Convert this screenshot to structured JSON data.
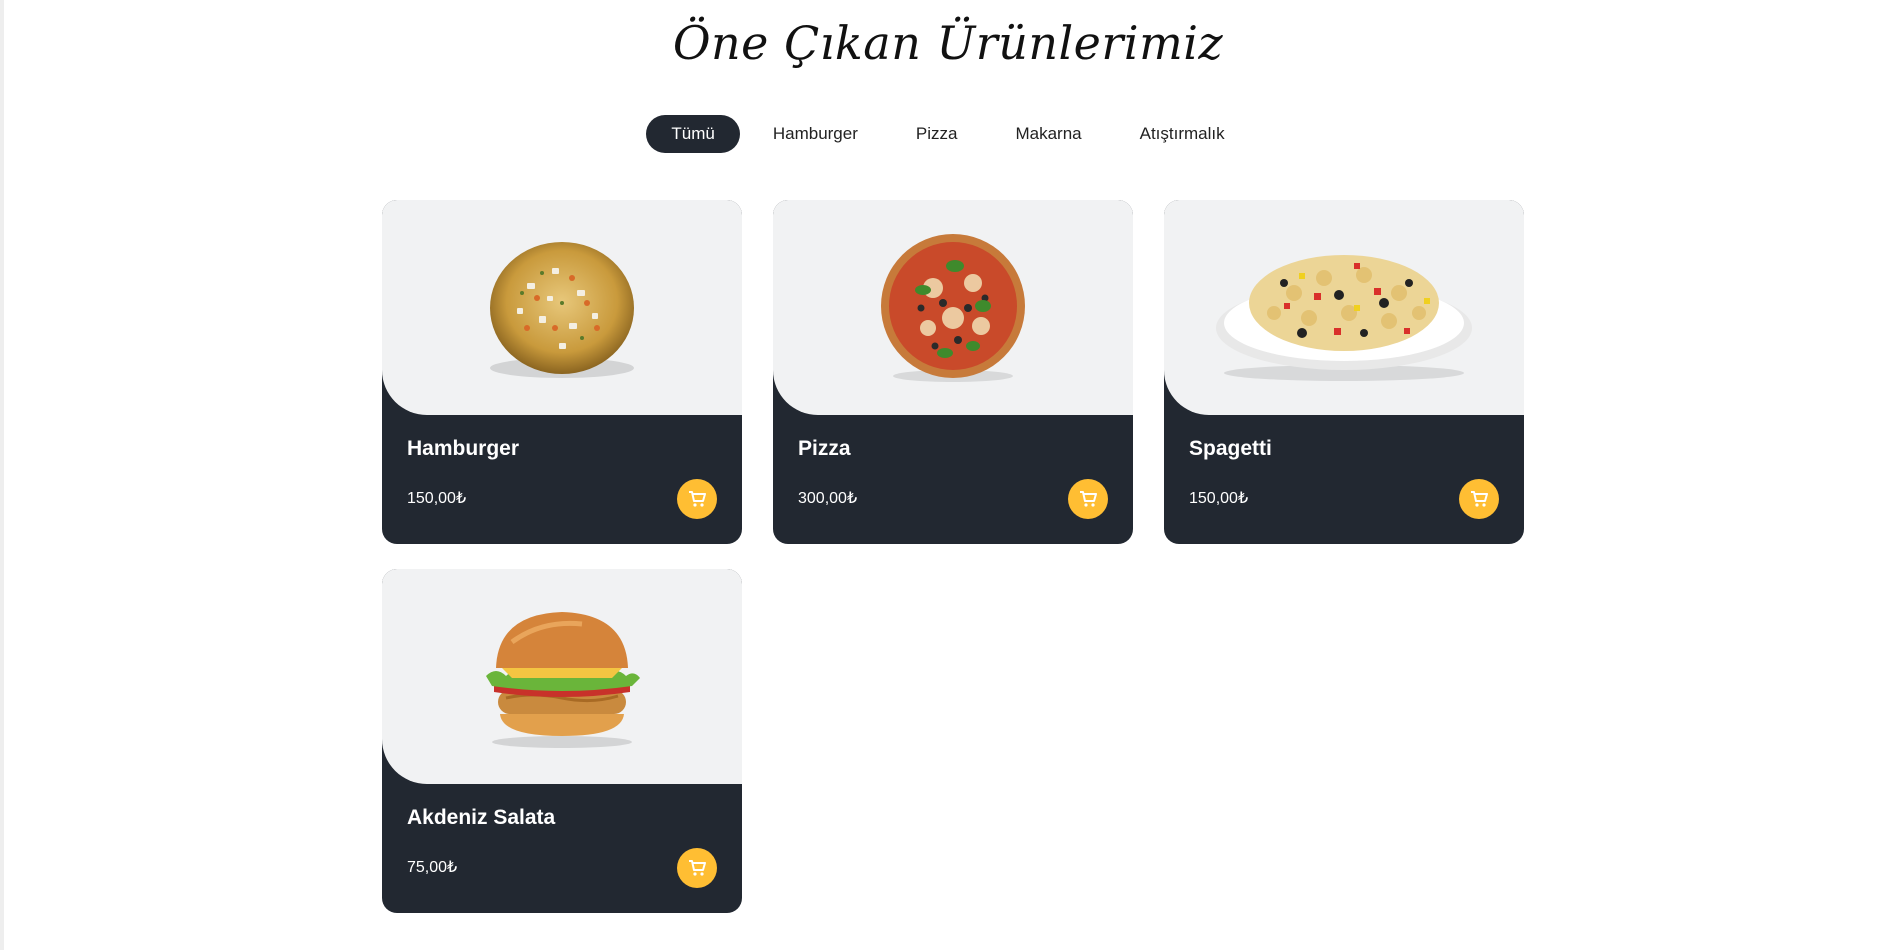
{
  "section": {
    "title": "Öne Çıkan Ürünlerimiz"
  },
  "filters": [
    {
      "label": "Tümü",
      "active": true
    },
    {
      "label": "Hamburger",
      "active": false
    },
    {
      "label": "Pizza",
      "active": false
    },
    {
      "label": "Makarna",
      "active": false
    },
    {
      "label": "Atıştırmalık",
      "active": false
    }
  ],
  "products": [
    {
      "name": "Hamburger",
      "price": "150,00₺",
      "image_icon": "pizza-dish-icon"
    },
    {
      "name": "Pizza",
      "price": "300,00₺",
      "image_icon": "pizza-icon"
    },
    {
      "name": "Spagetti",
      "price": "150,00₺",
      "image_icon": "pasta-plate-icon"
    },
    {
      "name": "Akdeniz Salata",
      "price": "75,00₺",
      "image_icon": "burger-icon"
    }
  ],
  "colors": {
    "card_dark": "#222831",
    "image_bg": "#f1f2f3",
    "accent": "#ffbe33",
    "active_tab": "#222831"
  }
}
